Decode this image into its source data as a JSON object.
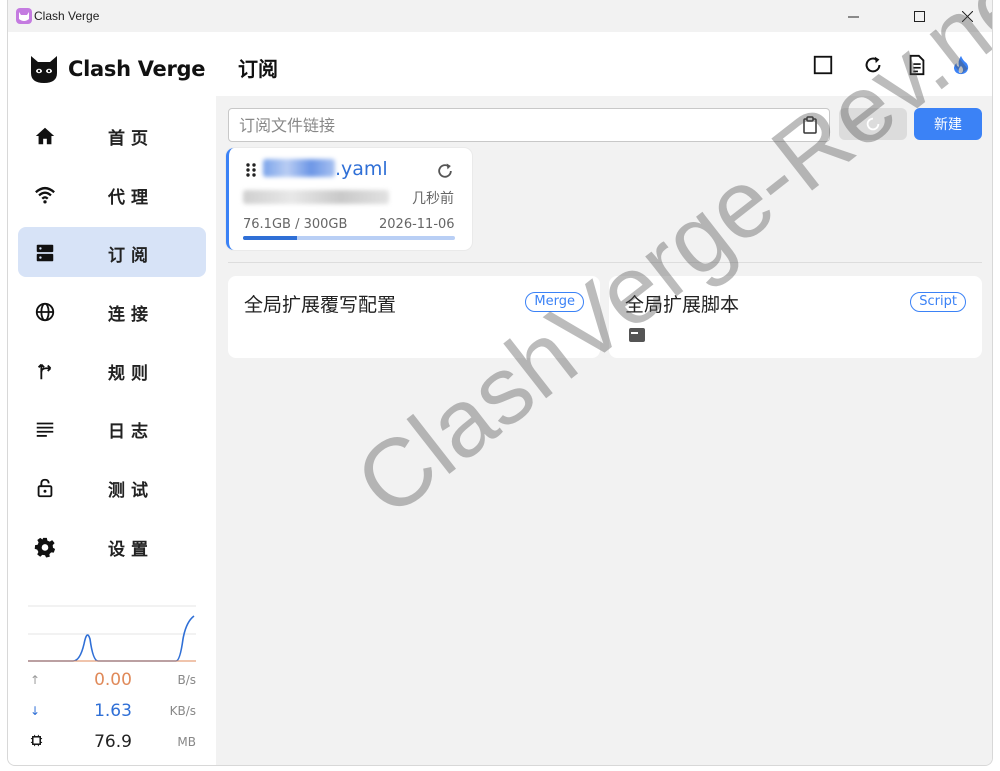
{
  "window": {
    "title": "Clash Verge",
    "controls": [
      "minimize",
      "maximize",
      "close"
    ]
  },
  "sidebar": {
    "logo_text": "Clash Verge",
    "items": [
      {
        "label": "首页",
        "icon": "home-icon",
        "active": false
      },
      {
        "label": "代理",
        "icon": "wifi-icon",
        "active": false
      },
      {
        "label": "订阅",
        "icon": "server-icon",
        "active": true
      },
      {
        "label": "连接",
        "icon": "globe-icon",
        "active": false
      },
      {
        "label": "规则",
        "icon": "fork-arrow-icon",
        "active": false
      },
      {
        "label": "日志",
        "icon": "list-icon",
        "active": false
      },
      {
        "label": "测试",
        "icon": "lock-icon",
        "active": false
      },
      {
        "label": "设置",
        "icon": "gear-icon",
        "active": false
      }
    ],
    "stats": {
      "upload": {
        "arrow": "↑",
        "value": "0.00",
        "unit": "B/s",
        "color": "#e08a5a"
      },
      "download": {
        "arrow": "↓",
        "value": "1.63",
        "unit": "KB/s",
        "color": "#2f6fd6"
      },
      "memory": {
        "value": "76.9",
        "unit": "MB"
      }
    }
  },
  "header": {
    "title": "订阅",
    "actions": [
      "square-icon",
      "refresh-icon",
      "document-icon",
      "fire-icon"
    ]
  },
  "import": {
    "placeholder": "订阅文件链接",
    "import_button": "",
    "new_button": "新建"
  },
  "profile": {
    "name_suffix": ".yaml",
    "updated": "几秒前",
    "usage": "76.1GB / 300GB",
    "expire": "2026-11-06",
    "usage_fraction": 0.254
  },
  "extensions": [
    {
      "title": "全局扩展覆写配置",
      "badge": "Merge"
    },
    {
      "title": "全局扩展脚本",
      "badge": "Script"
    }
  ],
  "watermark": "ClashVerge-Rev.net",
  "colors": {
    "accent": "#3b82f6",
    "active_nav": "#d7e3f7",
    "upload": "#e08a5a",
    "download": "#2f6fd6"
  }
}
